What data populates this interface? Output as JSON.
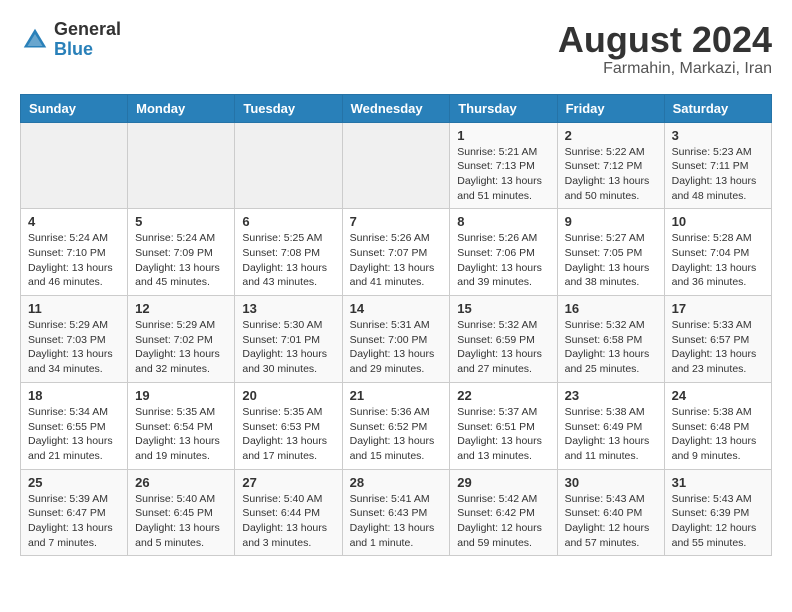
{
  "header": {
    "logo_general": "General",
    "logo_blue": "Blue",
    "main_title": "August 2024",
    "subtitle": "Farmahin, Markazi, Iran"
  },
  "calendar": {
    "days_of_week": [
      "Sunday",
      "Monday",
      "Tuesday",
      "Wednesday",
      "Thursday",
      "Friday",
      "Saturday"
    ],
    "weeks": [
      [
        {
          "num": "",
          "info": ""
        },
        {
          "num": "",
          "info": ""
        },
        {
          "num": "",
          "info": ""
        },
        {
          "num": "",
          "info": ""
        },
        {
          "num": "1",
          "info": "Sunrise: 5:21 AM\nSunset: 7:13 PM\nDaylight: 13 hours and 51 minutes."
        },
        {
          "num": "2",
          "info": "Sunrise: 5:22 AM\nSunset: 7:12 PM\nDaylight: 13 hours and 50 minutes."
        },
        {
          "num": "3",
          "info": "Sunrise: 5:23 AM\nSunset: 7:11 PM\nDaylight: 13 hours and 48 minutes."
        }
      ],
      [
        {
          "num": "4",
          "info": "Sunrise: 5:24 AM\nSunset: 7:10 PM\nDaylight: 13 hours and 46 minutes."
        },
        {
          "num": "5",
          "info": "Sunrise: 5:24 AM\nSunset: 7:09 PM\nDaylight: 13 hours and 45 minutes."
        },
        {
          "num": "6",
          "info": "Sunrise: 5:25 AM\nSunset: 7:08 PM\nDaylight: 13 hours and 43 minutes."
        },
        {
          "num": "7",
          "info": "Sunrise: 5:26 AM\nSunset: 7:07 PM\nDaylight: 13 hours and 41 minutes."
        },
        {
          "num": "8",
          "info": "Sunrise: 5:26 AM\nSunset: 7:06 PM\nDaylight: 13 hours and 39 minutes."
        },
        {
          "num": "9",
          "info": "Sunrise: 5:27 AM\nSunset: 7:05 PM\nDaylight: 13 hours and 38 minutes."
        },
        {
          "num": "10",
          "info": "Sunrise: 5:28 AM\nSunset: 7:04 PM\nDaylight: 13 hours and 36 minutes."
        }
      ],
      [
        {
          "num": "11",
          "info": "Sunrise: 5:29 AM\nSunset: 7:03 PM\nDaylight: 13 hours and 34 minutes."
        },
        {
          "num": "12",
          "info": "Sunrise: 5:29 AM\nSunset: 7:02 PM\nDaylight: 13 hours and 32 minutes."
        },
        {
          "num": "13",
          "info": "Sunrise: 5:30 AM\nSunset: 7:01 PM\nDaylight: 13 hours and 30 minutes."
        },
        {
          "num": "14",
          "info": "Sunrise: 5:31 AM\nSunset: 7:00 PM\nDaylight: 13 hours and 29 minutes."
        },
        {
          "num": "15",
          "info": "Sunrise: 5:32 AM\nSunset: 6:59 PM\nDaylight: 13 hours and 27 minutes."
        },
        {
          "num": "16",
          "info": "Sunrise: 5:32 AM\nSunset: 6:58 PM\nDaylight: 13 hours and 25 minutes."
        },
        {
          "num": "17",
          "info": "Sunrise: 5:33 AM\nSunset: 6:57 PM\nDaylight: 13 hours and 23 minutes."
        }
      ],
      [
        {
          "num": "18",
          "info": "Sunrise: 5:34 AM\nSunset: 6:55 PM\nDaylight: 13 hours and 21 minutes."
        },
        {
          "num": "19",
          "info": "Sunrise: 5:35 AM\nSunset: 6:54 PM\nDaylight: 13 hours and 19 minutes."
        },
        {
          "num": "20",
          "info": "Sunrise: 5:35 AM\nSunset: 6:53 PM\nDaylight: 13 hours and 17 minutes."
        },
        {
          "num": "21",
          "info": "Sunrise: 5:36 AM\nSunset: 6:52 PM\nDaylight: 13 hours and 15 minutes."
        },
        {
          "num": "22",
          "info": "Sunrise: 5:37 AM\nSunset: 6:51 PM\nDaylight: 13 hours and 13 minutes."
        },
        {
          "num": "23",
          "info": "Sunrise: 5:38 AM\nSunset: 6:49 PM\nDaylight: 13 hours and 11 minutes."
        },
        {
          "num": "24",
          "info": "Sunrise: 5:38 AM\nSunset: 6:48 PM\nDaylight: 13 hours and 9 minutes."
        }
      ],
      [
        {
          "num": "25",
          "info": "Sunrise: 5:39 AM\nSunset: 6:47 PM\nDaylight: 13 hours and 7 minutes."
        },
        {
          "num": "26",
          "info": "Sunrise: 5:40 AM\nSunset: 6:45 PM\nDaylight: 13 hours and 5 minutes."
        },
        {
          "num": "27",
          "info": "Sunrise: 5:40 AM\nSunset: 6:44 PM\nDaylight: 13 hours and 3 minutes."
        },
        {
          "num": "28",
          "info": "Sunrise: 5:41 AM\nSunset: 6:43 PM\nDaylight: 13 hours and 1 minute."
        },
        {
          "num": "29",
          "info": "Sunrise: 5:42 AM\nSunset: 6:42 PM\nDaylight: 12 hours and 59 minutes."
        },
        {
          "num": "30",
          "info": "Sunrise: 5:43 AM\nSunset: 6:40 PM\nDaylight: 12 hours and 57 minutes."
        },
        {
          "num": "31",
          "info": "Sunrise: 5:43 AM\nSunset: 6:39 PM\nDaylight: 12 hours and 55 minutes."
        }
      ]
    ]
  }
}
